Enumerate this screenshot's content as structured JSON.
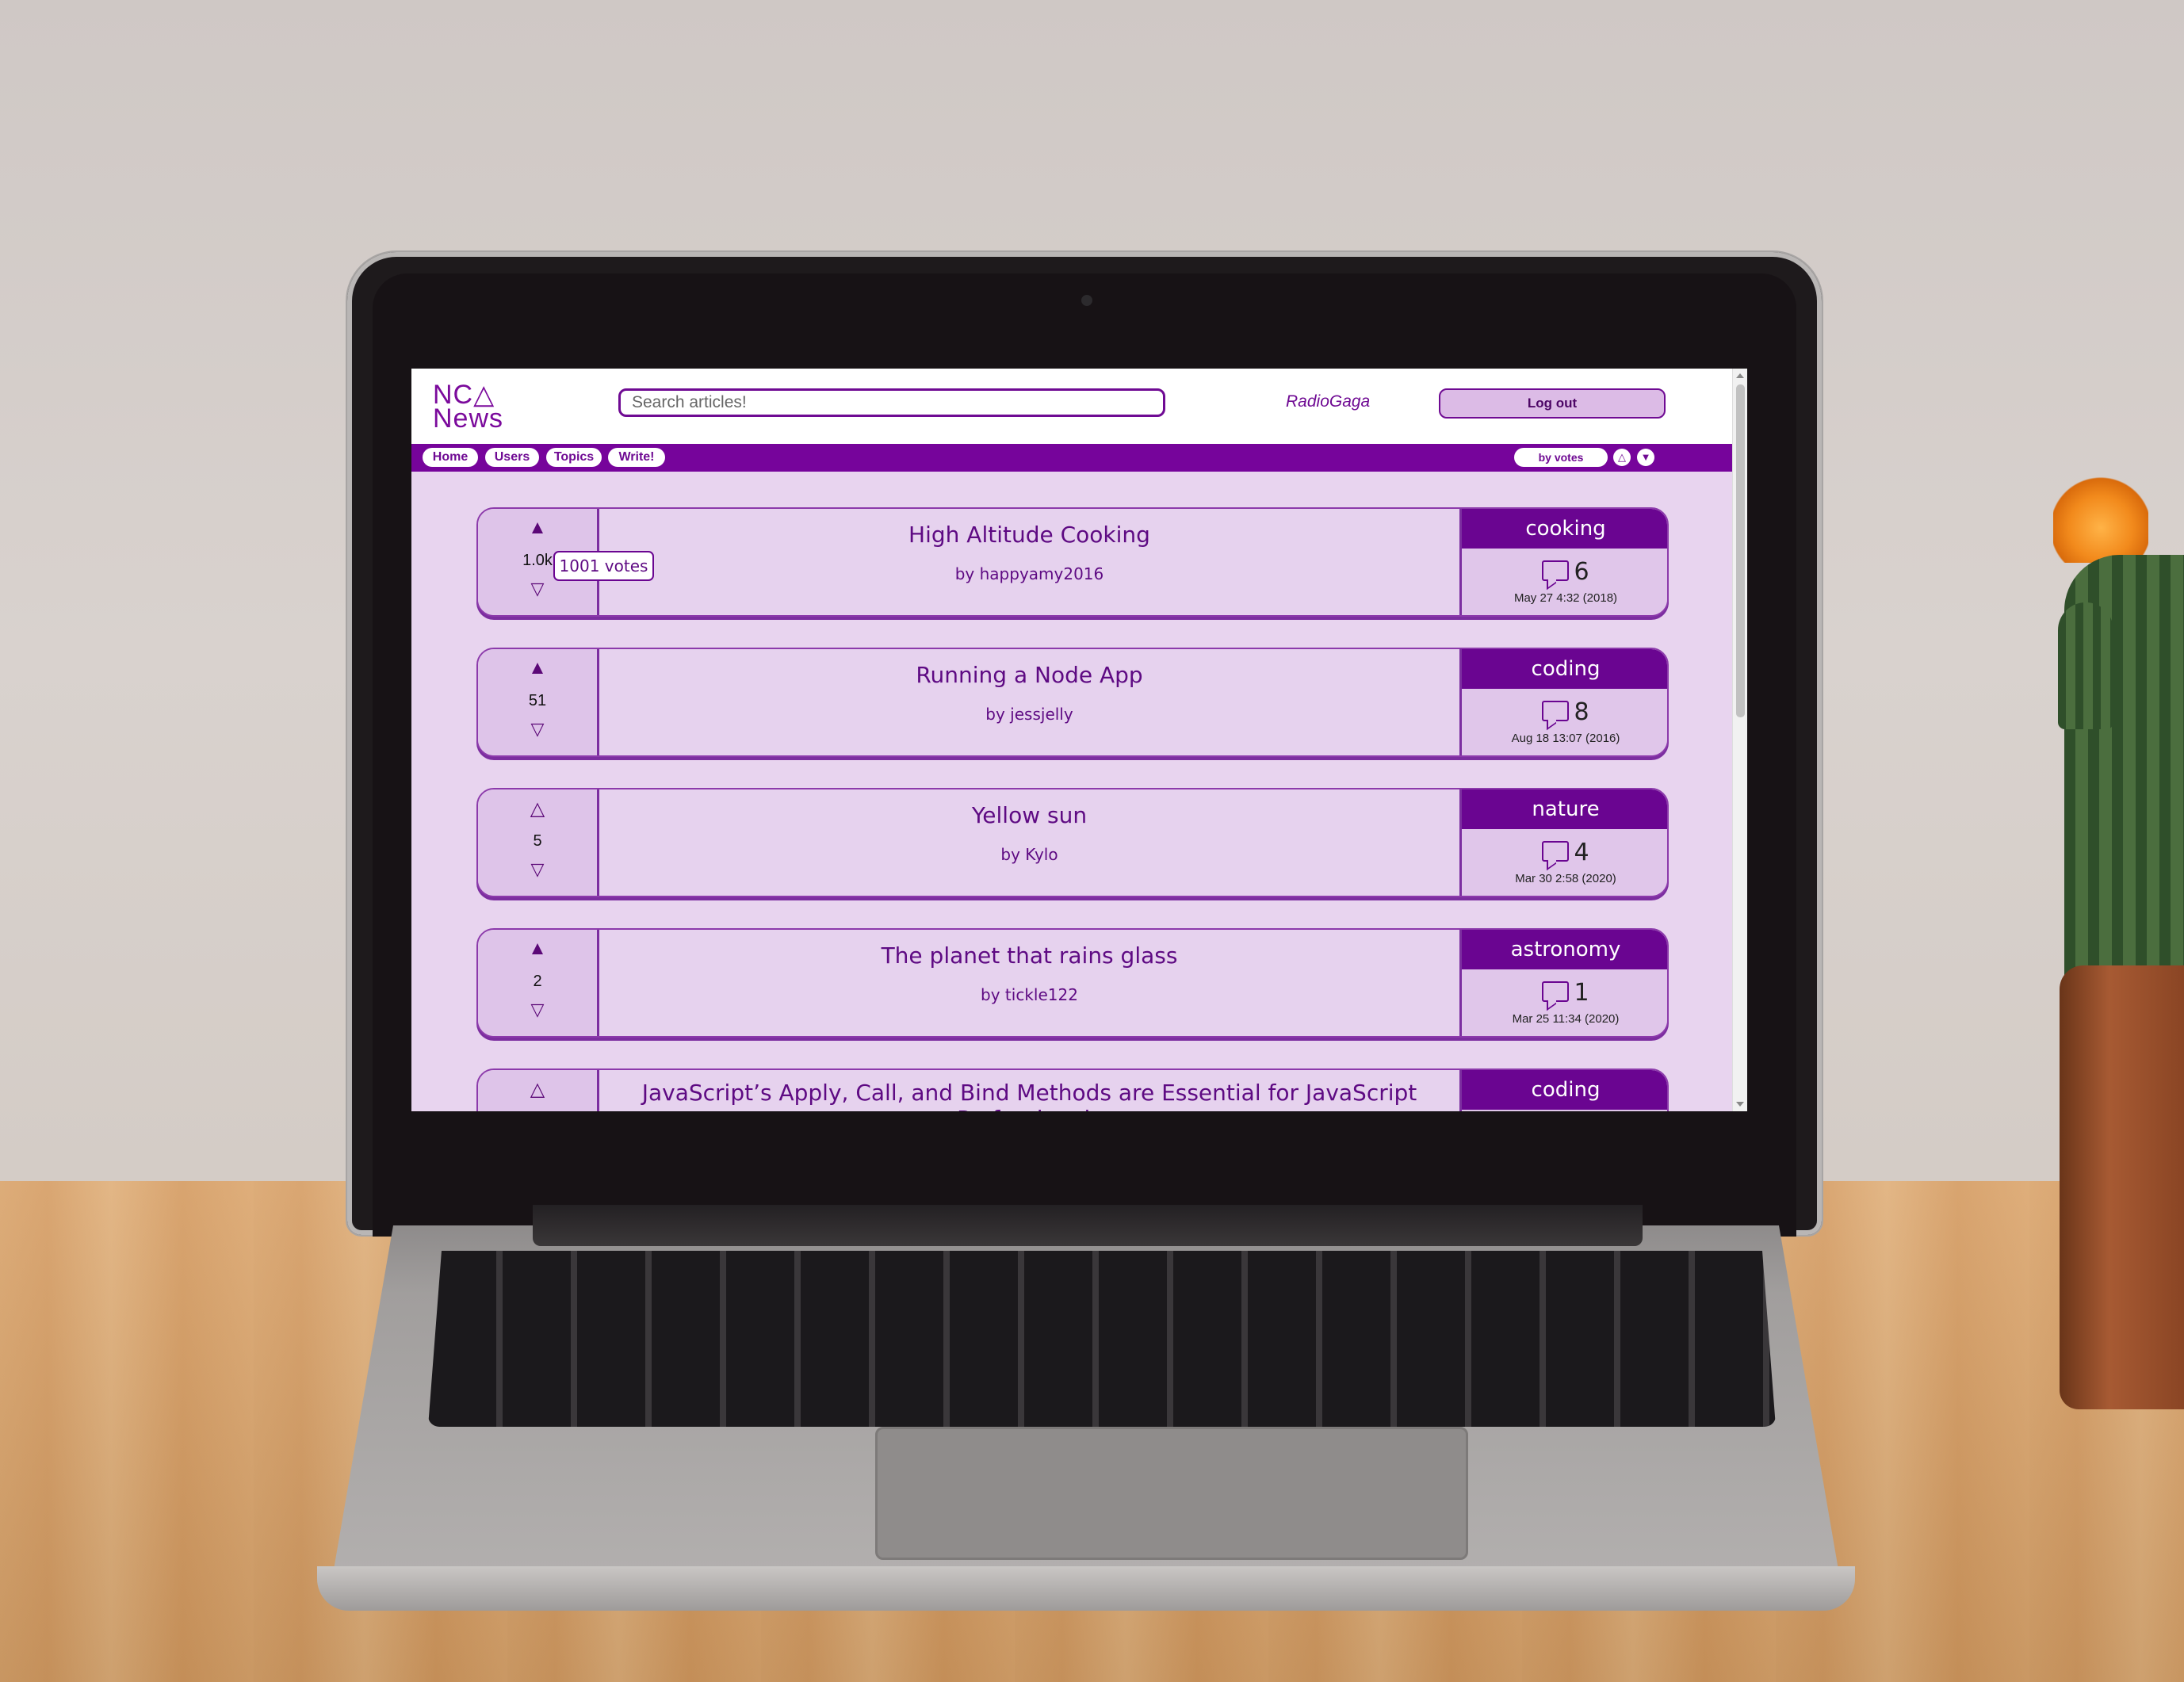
{
  "app": {
    "logo_line1": "NC△",
    "logo_line2": "News"
  },
  "header": {
    "search_placeholder": "Search articles!",
    "username": "RadioGaga",
    "logout_label": "Log out"
  },
  "nav": {
    "items": [
      "Home",
      "Users",
      "Topics",
      "Write!"
    ],
    "sort_selected": "by votes",
    "sort_asc_icon": "△",
    "sort_desc_icon": "▼"
  },
  "tooltip": "1001 votes",
  "articles": [
    {
      "title": "High Altitude Cooking",
      "author": "by happyamy2016",
      "votes": "1.0k",
      "upvoted": true,
      "topic": "cooking",
      "comments": "6",
      "date": "May 27 4:32 (2018)"
    },
    {
      "title": "Running a Node App",
      "author": "by jessjelly",
      "votes": "51",
      "upvoted": true,
      "topic": "coding",
      "comments": "8",
      "date": "Aug 18 13:07 (2016)"
    },
    {
      "title": "Yellow sun",
      "author": "by Kylo",
      "votes": "5",
      "upvoted": false,
      "topic": "nature",
      "comments": "4",
      "date": "Mar 30 2:58 (2020)"
    },
    {
      "title": "The planet that rains glass",
      "author": "by tickle122",
      "votes": "2",
      "upvoted": true,
      "topic": "astronomy",
      "comments": "1",
      "date": "Mar 25 11:34 (2020)"
    },
    {
      "title": "JavaScript’s Apply, Call, and Bind Methods are Essential for JavaScript Professionals",
      "author": "",
      "votes": "",
      "upvoted": false,
      "topic": "coding",
      "comments": "",
      "date": ""
    }
  ],
  "icons": {
    "upvote_filled": "▲",
    "upvote_outline": "△",
    "downvote": "▽",
    "comment": "comment-icon"
  },
  "colors": {
    "brand_purple": "#76049b",
    "card_bg": "#e6d2ee",
    "screen_bg": "#e8d4ef"
  }
}
